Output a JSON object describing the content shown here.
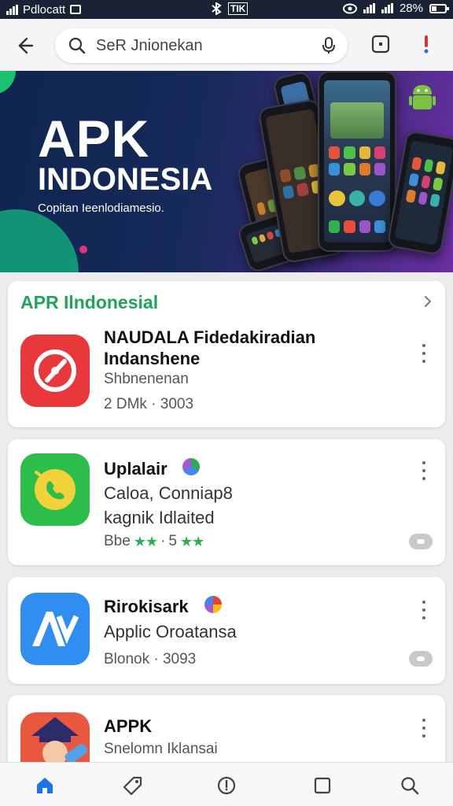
{
  "status_bar": {
    "carrier": "Pdlocatt",
    "center_label": "TIK",
    "battery": "28%"
  },
  "search": {
    "value": "SeR Jnionekan"
  },
  "banner": {
    "title": "APK",
    "subtitle": "INDONESIA",
    "tagline": "Copitan Ieenlodiamesio."
  },
  "section": {
    "title": "APR Ilndonesial"
  },
  "apps": [
    {
      "title": "NAUDALA Fidedakiradian Indanshene",
      "line": "Shbnenenan",
      "meta": "2 DMk · 3003"
    },
    {
      "title": "Uplalair",
      "line": "Caloa, Conniap8",
      "line2": "kagnik Idlaited",
      "meta_prefix": "Bbe",
      "stars_a": "★★",
      "separator": "·",
      "rating": "5",
      "stars_b": "★★"
    },
    {
      "title": "Rirokisark",
      "line": "Applic Oroatansa",
      "meta": "Blonok · 3093"
    },
    {
      "title": "APPK",
      "line": "Snelomn Iklansai"
    }
  ],
  "colors": {
    "accent_green": "#1fa55a",
    "star_green": "#29b24a",
    "status_bar_bg": "#1c2235"
  },
  "icons": [
    "back-arrow-icon",
    "search-icon",
    "mic-icon",
    "square-icon",
    "exclamation-icon",
    "chevron-right-icon",
    "home-icon",
    "tag-icon",
    "compass-icon",
    "square-nav-icon",
    "search-nav-icon",
    "more-vert-icon"
  ]
}
